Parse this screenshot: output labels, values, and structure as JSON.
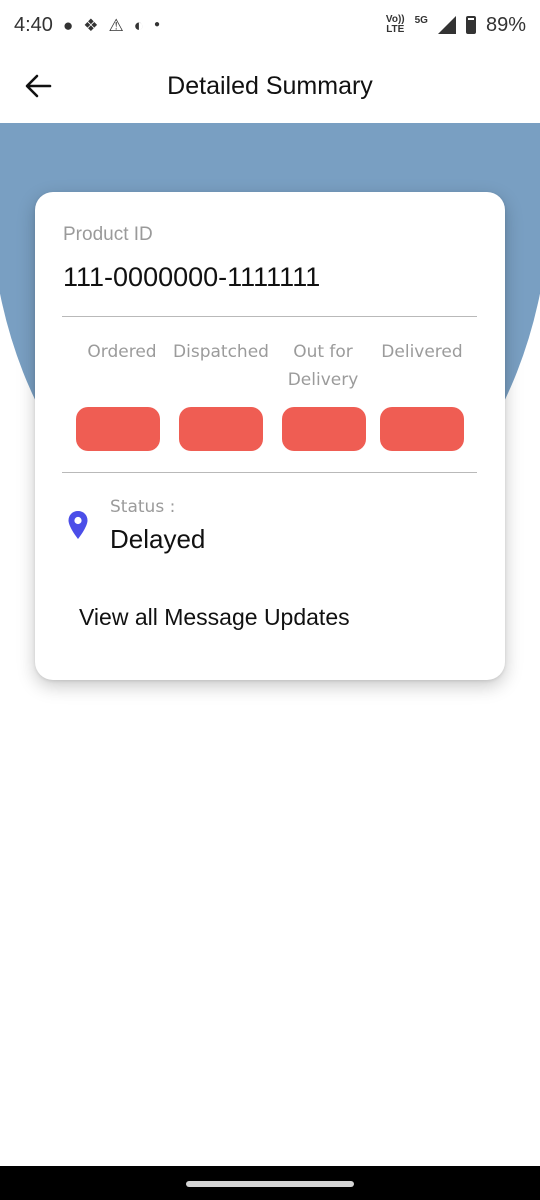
{
  "status_bar": {
    "time": "4:40",
    "network_top": "Vo))",
    "network_bottom": "LTE",
    "signal_type": "5G",
    "battery": "89%",
    "icons": [
      "chat-bubble-icon",
      "app-icon",
      "warning-icon",
      "moon-icon",
      "dot-icon",
      "signal-icon",
      "battery-icon"
    ]
  },
  "app_bar": {
    "title": "Detailed Summary",
    "back_icon": "arrow-left-icon"
  },
  "card": {
    "product_id_label": "Product ID",
    "product_id": "111-0000000-1111111",
    "steps": [
      {
        "label": "Ordered"
      },
      {
        "label": "Dispatched"
      },
      {
        "label": "Out for Delivery"
      },
      {
        "label": "Delivered"
      }
    ],
    "step_color": "#ef5d53",
    "status_label": "Status :",
    "status_value": "Delayed",
    "location_icon": "location-pin-icon",
    "pin_color": "#4b4ee8",
    "message_link": "View all Message Updates"
  },
  "colors": {
    "hero": "#799fc2",
    "background": "#ffffff"
  }
}
